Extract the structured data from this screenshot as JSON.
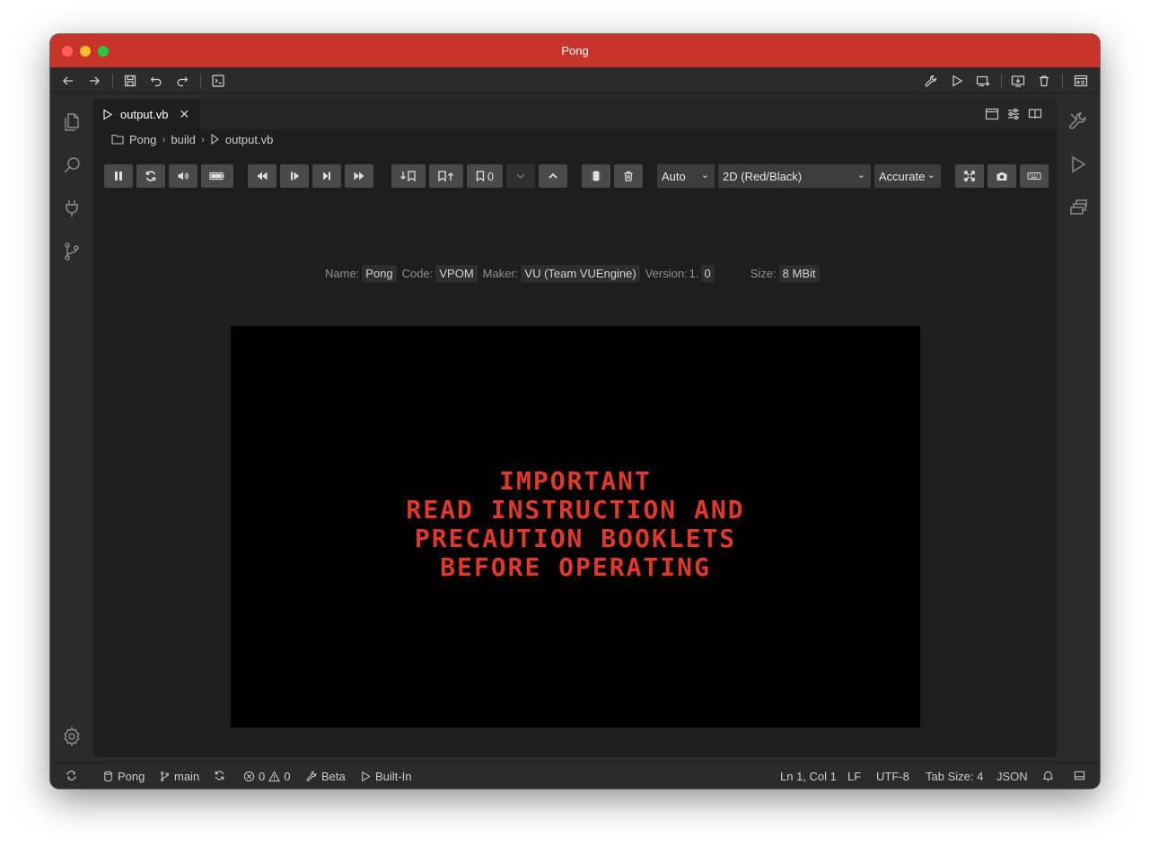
{
  "window": {
    "title": "Pong"
  },
  "colors": {
    "titlebar": "#c8342a",
    "screen_text": "#e0392b",
    "background": "#1e1e1e"
  },
  "tab": {
    "label": "output.vb"
  },
  "breadcrumb": {
    "items": [
      "Pong",
      "build",
      "output.vb"
    ]
  },
  "toolbar": {
    "bookmark_count": "0",
    "palette_select": "Auto",
    "display_mode_select": "2D (Red/Black)",
    "emulation_select": "Accurate"
  },
  "rom_info": {
    "name_label": "Name:",
    "name": "Pong",
    "code_label": "Code:",
    "code": "VPOM",
    "maker_label": "Maker:",
    "maker": "VU (Team VUEngine)",
    "version_label": "Version:",
    "version_major": "1.",
    "version_minor": "0",
    "size_label": "Size:",
    "size": "8 MBit"
  },
  "screen": {
    "line1": "IMPORTANT",
    "line2": "READ INSTRUCTION AND",
    "line3": "PRECAUTION BOOKLETS",
    "line4": "BEFORE OPERATING"
  },
  "statusbar": {
    "project": "Pong",
    "branch": "main",
    "errors": "0",
    "warnings": "0",
    "channel": "Beta",
    "emulator": "Built-In",
    "position": "Ln 1, Col 1",
    "eol": "LF",
    "encoding": "UTF-8",
    "tab_size": "Tab Size: 4",
    "language": "JSON"
  }
}
